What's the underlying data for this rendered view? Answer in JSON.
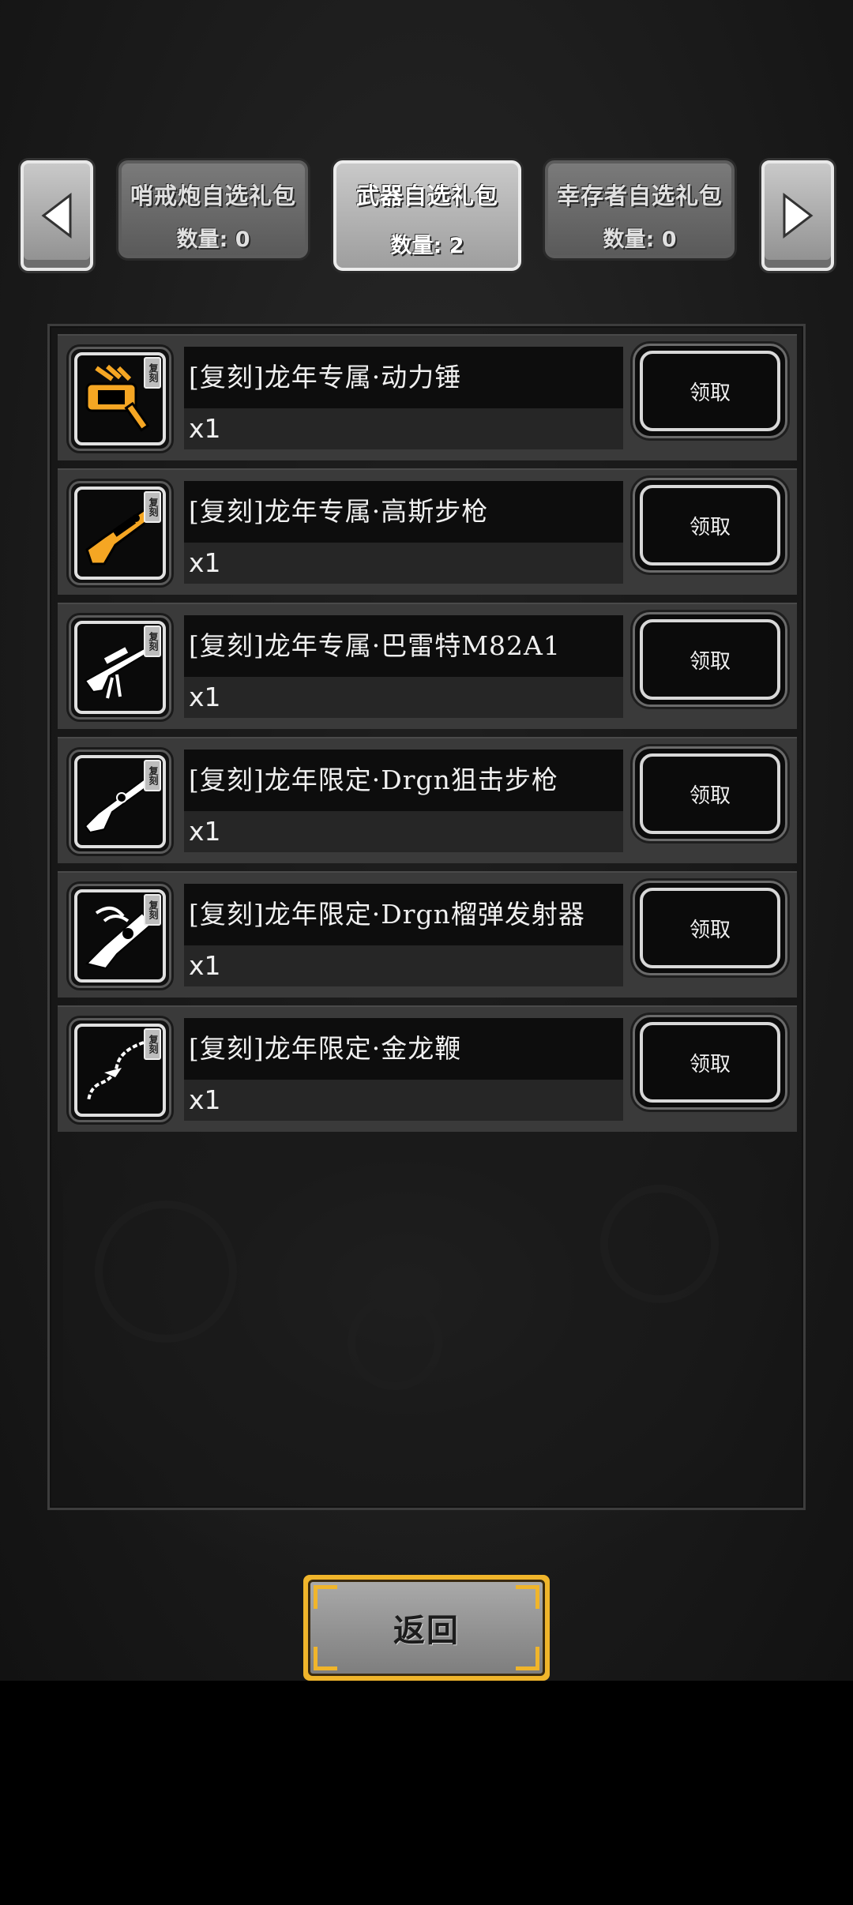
{
  "tabs": [
    {
      "name": "哨戒炮自选礼包",
      "count_label": "数量: 0",
      "active": false
    },
    {
      "name": "武器自选礼包",
      "count_label": "数量: 2",
      "active": true
    },
    {
      "name": "幸存者自选礼包",
      "count_label": "数量: 0",
      "active": false
    }
  ],
  "badge_text": "复刻",
  "items": [
    {
      "name": "[复刻]龙年专属·动力锤",
      "qty": "x1",
      "claim_label": "领取",
      "icon": "power-hammer-icon",
      "icon_color": "#f5a623"
    },
    {
      "name": "[复刻]龙年专属·高斯步枪",
      "qty": "x1",
      "claim_label": "领取",
      "icon": "gauss-rifle-icon",
      "icon_color": "#f5a623"
    },
    {
      "name": "[复刻]龙年专属·巴雷特M82A1",
      "qty": "x1",
      "claim_label": "领取",
      "icon": "barrett-rifle-icon",
      "icon_color": "#ffffff"
    },
    {
      "name": "[复刻]龙年限定·Drgn狙击步枪",
      "qty": "x1",
      "claim_label": "领取",
      "icon": "sniper-rifle-icon",
      "icon_color": "#ffffff"
    },
    {
      "name": "[复刻]龙年限定·Drgn榴弹发射器",
      "qty": "x1",
      "claim_label": "领取",
      "icon": "grenade-launcher-icon",
      "icon_color": "#ffffff"
    },
    {
      "name": "[复刻]龙年限定·金龙鞭",
      "qty": "x1",
      "claim_label": "领取",
      "icon": "dragon-whip-icon",
      "icon_color": "#ffffff"
    }
  ],
  "back_label": "返回",
  "colors": {
    "gold": "#f0b52b",
    "orange_weapon": "#f5a623"
  }
}
